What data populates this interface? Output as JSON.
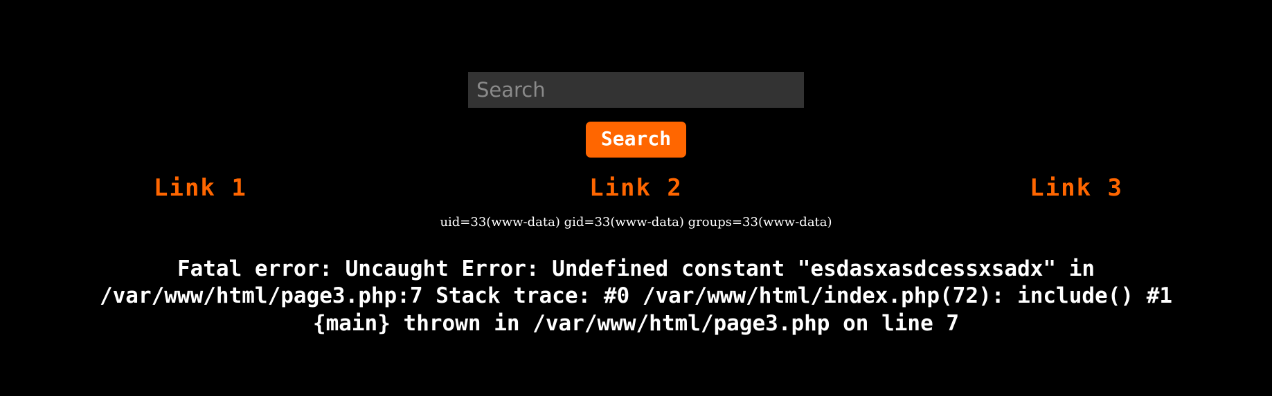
{
  "page": {
    "background_color": "#000000",
    "text_color": "#ffffff",
    "accent_color": "#ff6600"
  },
  "search": {
    "placeholder": "Search",
    "value": "",
    "button_label": "Search",
    "input_background": "#333333",
    "placeholder_color": "#8a8a8a",
    "button_background": "#ff6600",
    "button_text_color": "#ffffff"
  },
  "nav": {
    "link_color": "#ff6600",
    "links": [
      {
        "label": "Link 1"
      },
      {
        "label": "Link 2"
      },
      {
        "label": "Link 3"
      }
    ]
  },
  "id_output": {
    "text": "uid=33(www-data) gid=33(www-data) groups=33(www-data)"
  },
  "php_error": {
    "line1": "Fatal error: Uncaught Error: Undefined constant \"esdasxasdcessxsadx\" in",
    "line2": "/var/www/html/page3.php:7 Stack trace: #0 /var/www/html/index.php(72): include() #1",
    "line3": "{main} thrown in /var/www/html/page3.php on line 7"
  }
}
